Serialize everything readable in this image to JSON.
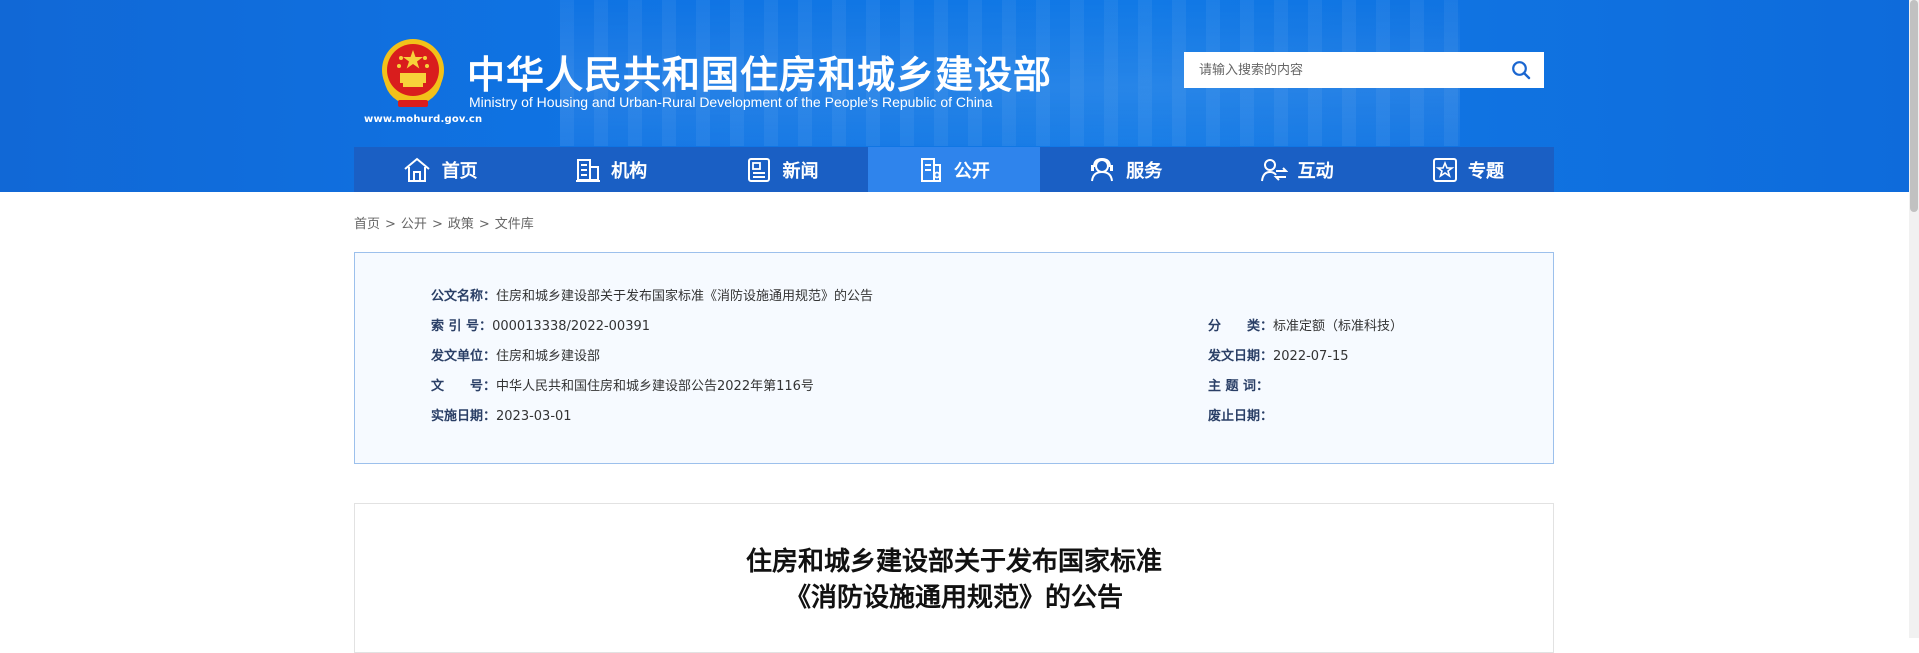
{
  "header": {
    "title_cn": "中华人民共和国住房和城乡建设部",
    "title_en": "Ministry of Housing and Urban-Rural Development of the People’s Republic of China",
    "site_url": "www.mohurd.gov.cn",
    "emblem": "national-emblem",
    "search": {
      "placeholder": "请输入搜索的内容",
      "value": "",
      "icon": "search-icon"
    }
  },
  "nav": {
    "items": [
      {
        "label": "首页",
        "icon": "home-icon",
        "active": false
      },
      {
        "label": "机构",
        "icon": "building-icon",
        "active": false
      },
      {
        "label": "新闻",
        "icon": "news-icon",
        "active": false
      },
      {
        "label": "公开",
        "icon": "document-icon",
        "active": true
      },
      {
        "label": "服务",
        "icon": "service-icon",
        "active": false
      },
      {
        "label": "互动",
        "icon": "interaction-icon",
        "active": false
      },
      {
        "label": "专题",
        "icon": "star-icon",
        "active": false
      }
    ]
  },
  "breadcrumb": {
    "items": [
      "首页",
      "公开",
      "政策",
      "文件库"
    ],
    "separator": ">"
  },
  "doc_info": {
    "name": {
      "label": "公文名称：",
      "value": "住房和城乡建设部关于发布国家标准《消防设施通用规范》的公告"
    },
    "index": {
      "label": "索 引 号：",
      "value": "000013338/2022-00391"
    },
    "category": {
      "label": "分　　类：",
      "value": "标准定额（标准科技）"
    },
    "issuer": {
      "label": "发文单位：",
      "value": "住房和城乡建设部"
    },
    "issue_date": {
      "label": "发文日期：",
      "value": "2022-07-15"
    },
    "doc_number": {
      "label": "文　　号：",
      "value": "中华人民共和国住房和城乡建设部公告2022年第116号"
    },
    "keywords": {
      "label": "主 题 词：",
      "value": ""
    },
    "effective": {
      "label": "实施日期：",
      "value": "2023-03-01"
    },
    "repealed": {
      "label": "废止日期：",
      "value": ""
    }
  },
  "article": {
    "title_line1": "住房和城乡建设部关于发布国家标准",
    "title_line2": "《消防设施通用规范》的公告"
  },
  "colors": {
    "header_blue": "#0f73e3",
    "nav_bg": "#1a5fc4",
    "nav_active": "#2f84ec",
    "info_border": "#9cc0ec",
    "info_bg": "#f6faff",
    "label_color": "#2a3f66"
  }
}
